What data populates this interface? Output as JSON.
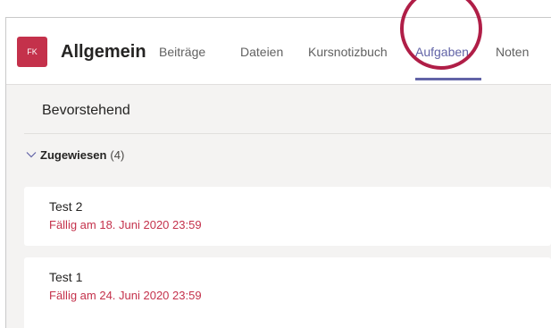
{
  "channel": {
    "avatar_initials": "FK",
    "name": "Allgemein"
  },
  "tabs": [
    {
      "label": "Beiträge"
    },
    {
      "label": "Dateien"
    },
    {
      "label": "Kursnotizbuch"
    },
    {
      "label": "Aufgaben",
      "active": true
    },
    {
      "label": "Noten"
    }
  ],
  "section": {
    "title": "Bevorstehend"
  },
  "group": {
    "label": "Zugewiesen",
    "count": "(4)"
  },
  "assignments": [
    {
      "title": "Test 2",
      "due": "Fällig am 18. Juni 2020 23:59"
    },
    {
      "title": "Test 1",
      "due": "Fällig am 24. Juni 2020 23:59"
    }
  ],
  "colors": {
    "accent": "#6264a7",
    "avatar": "#c4314b",
    "due_text": "#c4314b",
    "highlight_circle": "#b01e47"
  }
}
